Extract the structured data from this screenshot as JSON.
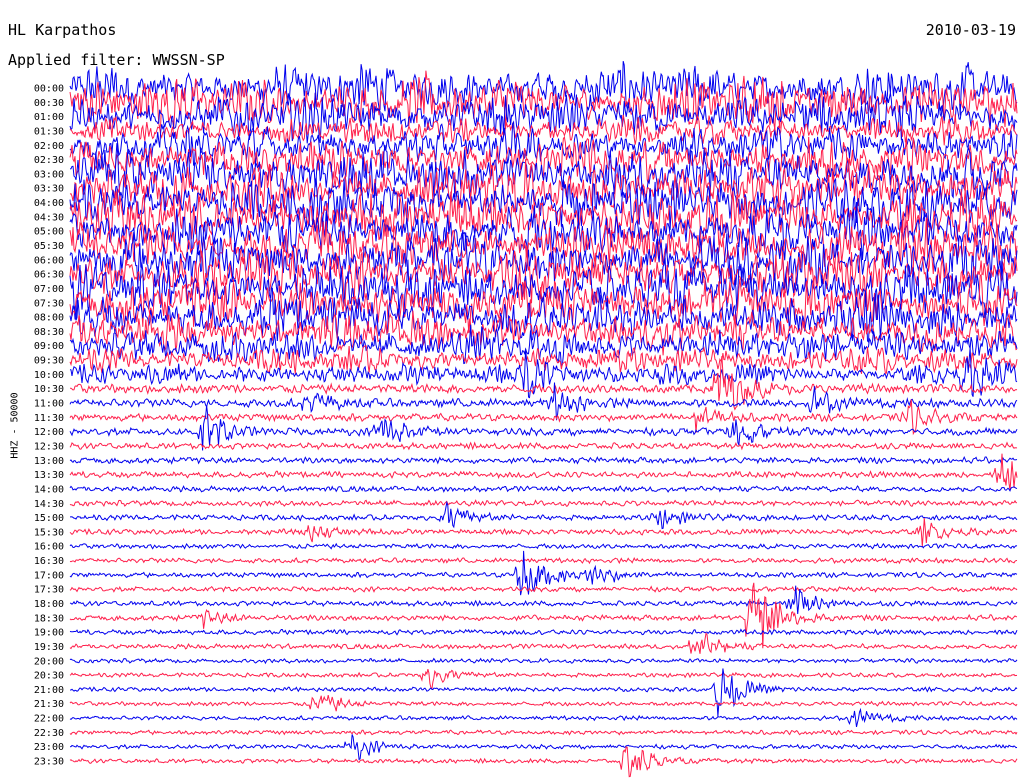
{
  "header": {
    "station": "HL Karpathos",
    "date": "2010-03-19",
    "filter": "Applied filter: WWSSN-SP"
  },
  "chart_data": {
    "type": "line",
    "title": "HL Karpathos",
    "subtitle": "Applied filter: WWSSN-SP",
    "date": "2010-03-19",
    "ylabel": "HHZ - 50000",
    "xlabel": "",
    "trace_minutes": 30,
    "colors": [
      "#0000ee",
      "#ff1f4b"
    ],
    "rows": [
      {
        "label": "00:00",
        "amplitude": 0.9,
        "events": []
      },
      {
        "label": "00:30",
        "amplitude": 1.0,
        "events": []
      },
      {
        "label": "01:00",
        "amplitude": 0.9,
        "events": []
      },
      {
        "label": "01:30",
        "amplitude": 0.55,
        "events": []
      },
      {
        "label": "02:00",
        "amplitude": 0.75,
        "events": []
      },
      {
        "label": "02:30",
        "amplitude": 0.85,
        "events": []
      },
      {
        "label": "03:00",
        "amplitude": 1.0,
        "events": []
      },
      {
        "label": "03:30",
        "amplitude": 1.0,
        "events": []
      },
      {
        "label": "04:00",
        "amplitude": 1.0,
        "events": []
      },
      {
        "label": "04:30",
        "amplitude": 1.0,
        "events": []
      },
      {
        "label": "05:00",
        "amplitude": 1.0,
        "events": []
      },
      {
        "label": "05:30",
        "amplitude": 1.0,
        "events": []
      },
      {
        "label": "06:00",
        "amplitude": 1.0,
        "events": []
      },
      {
        "label": "06:30",
        "amplitude": 1.0,
        "events": []
      },
      {
        "label": "07:00",
        "amplitude": 1.0,
        "events": []
      },
      {
        "label": "07:30",
        "amplitude": 1.0,
        "events": []
      },
      {
        "label": "08:00",
        "amplitude": 0.9,
        "events": []
      },
      {
        "label": "08:30",
        "amplitude": 0.75,
        "events": []
      },
      {
        "label": "09:00",
        "amplitude": 0.7,
        "events": []
      },
      {
        "label": "09:30",
        "amplitude": 0.5,
        "events": []
      },
      {
        "label": "10:00",
        "amplitude": 0.4,
        "events": [
          {
            "t": 14.4,
            "a": 1.2
          },
          {
            "t": 28.4,
            "a": 0.9
          }
        ]
      },
      {
        "label": "10:30",
        "amplitude": 0.15,
        "events": [
          {
            "t": 20.5,
            "a": 1.6
          }
        ]
      },
      {
        "label": "11:00",
        "amplitude": 0.14,
        "events": [
          {
            "t": 15.3,
            "a": 0.6
          },
          {
            "t": 7.5,
            "a": 0.5
          },
          {
            "t": 23.5,
            "a": 0.5
          }
        ]
      },
      {
        "label": "11:30",
        "amplitude": 0.12,
        "events": [
          {
            "t": 26.5,
            "a": 0.6
          },
          {
            "t": 19.8,
            "a": 0.5
          }
        ]
      },
      {
        "label": "12:00",
        "amplitude": 0.12,
        "events": [
          {
            "t": 4.2,
            "a": 0.9
          },
          {
            "t": 9.8,
            "a": 0.8
          },
          {
            "t": 21.0,
            "a": 0.6
          }
        ]
      },
      {
        "label": "12:30",
        "amplitude": 0.1,
        "events": []
      },
      {
        "label": "13:00",
        "amplitude": 0.1,
        "events": []
      },
      {
        "label": "13:30",
        "amplitude": 0.1,
        "events": [
          {
            "t": 29.5,
            "a": 0.8
          }
        ]
      },
      {
        "label": "14:00",
        "amplitude": 0.09,
        "events": []
      },
      {
        "label": "14:30",
        "amplitude": 0.09,
        "events": []
      },
      {
        "label": "15:00",
        "amplitude": 0.09,
        "events": [
          {
            "t": 11.9,
            "a": 0.6
          },
          {
            "t": 18.6,
            "a": 0.4
          }
        ]
      },
      {
        "label": "15:30",
        "amplitude": 0.09,
        "events": [
          {
            "t": 7.4,
            "a": 0.4
          },
          {
            "t": 27.0,
            "a": 0.4
          }
        ]
      },
      {
        "label": "16:00",
        "amplitude": 0.08,
        "events": []
      },
      {
        "label": "16:30",
        "amplitude": 0.08,
        "events": []
      },
      {
        "label": "17:00",
        "amplitude": 0.08,
        "events": [
          {
            "t": 14.2,
            "a": 1.6
          },
          {
            "t": 16.5,
            "a": 0.5
          }
        ]
      },
      {
        "label": "17:30",
        "amplitude": 0.08,
        "events": []
      },
      {
        "label": "18:00",
        "amplitude": 0.08,
        "events": [
          {
            "t": 22.9,
            "a": 0.8
          }
        ]
      },
      {
        "label": "18:30",
        "amplitude": 0.09,
        "events": [
          {
            "t": 21.6,
            "a": 2.0
          },
          {
            "t": 4.2,
            "a": 0.3
          }
        ]
      },
      {
        "label": "19:00",
        "amplitude": 0.08,
        "events": []
      },
      {
        "label": "19:30",
        "amplitude": 0.08,
        "events": [
          {
            "t": 19.8,
            "a": 0.7
          }
        ]
      },
      {
        "label": "20:00",
        "amplitude": 0.07,
        "events": []
      },
      {
        "label": "20:30",
        "amplitude": 0.07,
        "events": [
          {
            "t": 11.3,
            "a": 0.5
          }
        ]
      },
      {
        "label": "21:00",
        "amplitude": 0.07,
        "events": [
          {
            "t": 20.5,
            "a": 1.2
          }
        ]
      },
      {
        "label": "21:30",
        "amplitude": 0.07,
        "events": [
          {
            "t": 7.8,
            "a": 0.5
          }
        ]
      },
      {
        "label": "22:00",
        "amplitude": 0.07,
        "events": [
          {
            "t": 24.8,
            "a": 0.4
          }
        ]
      },
      {
        "label": "22:30",
        "amplitude": 0.07,
        "events": []
      },
      {
        "label": "23:00",
        "amplitude": 0.07,
        "events": [
          {
            "t": 8.9,
            "a": 0.5
          }
        ]
      },
      {
        "label": "23:30",
        "amplitude": 0.07,
        "events": [
          {
            "t": 17.6,
            "a": 0.9
          }
        ]
      }
    ]
  }
}
